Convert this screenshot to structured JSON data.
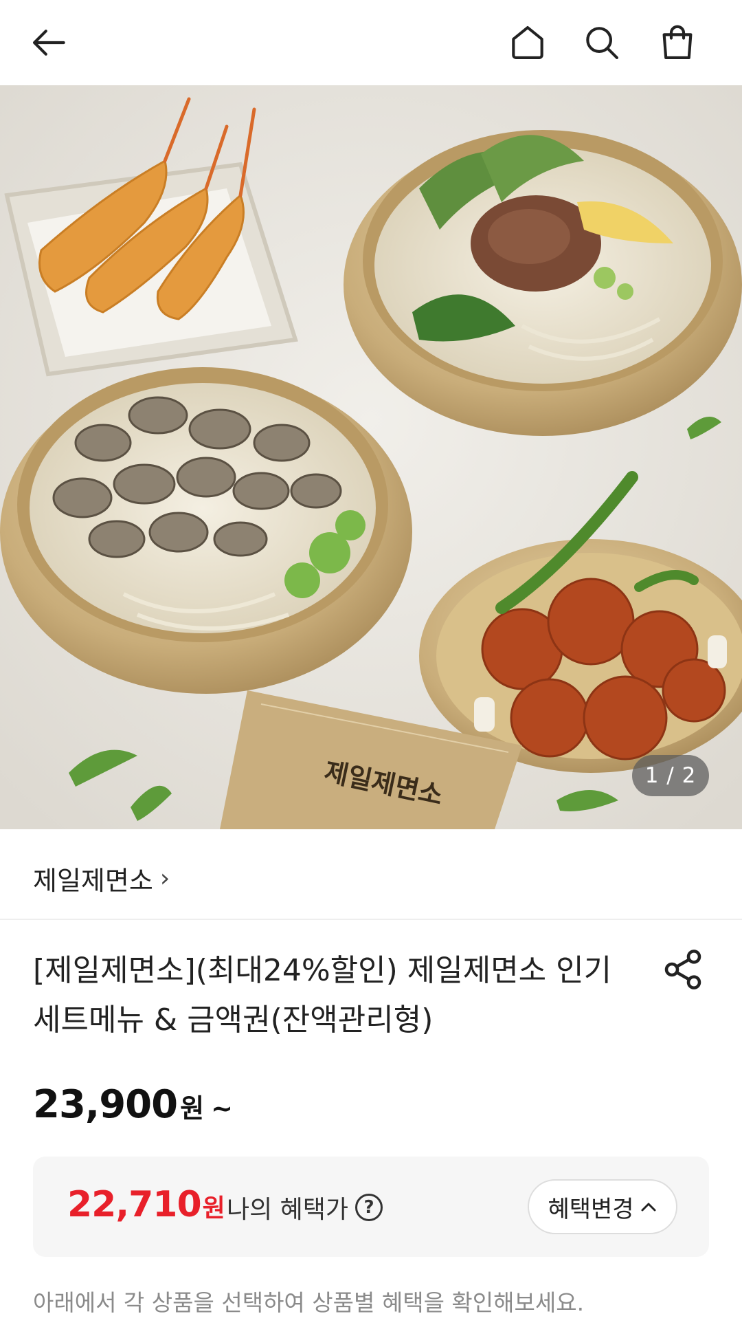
{
  "nav": {
    "icons": [
      "back-arrow-icon",
      "home-icon",
      "search-icon",
      "shopping-bag-icon"
    ]
  },
  "hero": {
    "image_desc_icon": "food-photo",
    "counter": "1 / 2",
    "card_text": "제일제면소"
  },
  "brand": {
    "name": "제일제면소",
    "chevron": "›"
  },
  "product": {
    "title": "[제일제면소](최대24%할인) 제일제면소 인기세트메뉴 & 금액권(잔액관리형)"
  },
  "price": {
    "amount": "23,900",
    "unit": "원",
    "suffix": "~"
  },
  "benefit": {
    "amount": "22,710",
    "unit": "원",
    "label": "나의 혜택가",
    "help": "?",
    "change_label": "혜택변경",
    "change_chevron": "^"
  },
  "hint": "아래에서 각 상품을 선택하여 상품별 혜택을 확인해보세요.",
  "colors": {
    "accent_red": "#e8202a",
    "box_bg": "#f6f6f6"
  }
}
